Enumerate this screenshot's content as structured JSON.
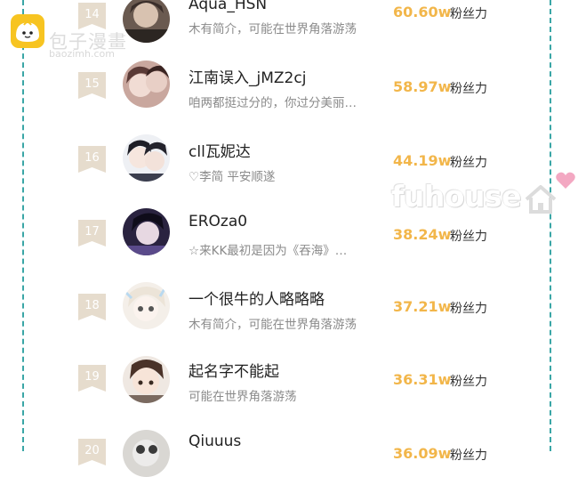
{
  "brand": {
    "title": "包子漫畫",
    "domain": "baozimh.com",
    "icon": "baozi-mascot-icon",
    "accent": "#f7c421"
  },
  "watermark": {
    "text": "fuhouse",
    "icon": "house-heart-icon",
    "heart_color": "#f3a8c2"
  },
  "colors": {
    "fans_number": "#f2b64a",
    "rank_badge": "#e6dccd",
    "dashed_border": "#3aa6a6"
  },
  "ranking": [
    {
      "rank": "14",
      "name": "Aqua_HSN",
      "desc": "木有简介，可能在世界角落游荡",
      "fans": "60.60w",
      "fans_label": "粉丝力"
    },
    {
      "rank": "15",
      "name": "江南误入_jMZ2cj",
      "desc": "咱两都挺过分的，你过分美丽…",
      "fans": "58.97w",
      "fans_label": "粉丝力"
    },
    {
      "rank": "16",
      "name": "cll瓦妮达",
      "desc": "♡李简 平安顺遂",
      "fans": "44.19w",
      "fans_label": "粉丝力"
    },
    {
      "rank": "17",
      "name": "EROza0",
      "desc": "☆来KK最初是因为《吞海》…",
      "fans": "38.24w",
      "fans_label": "粉丝力"
    },
    {
      "rank": "18",
      "name": "一个很牛的人略略略",
      "desc": "木有简介，可能在世界角落游荡",
      "fans": "37.21w",
      "fans_label": "粉丝力"
    },
    {
      "rank": "19",
      "name": "起名字不能起",
      "desc": "可能在世界角落游荡",
      "fans": "36.31w",
      "fans_label": "粉丝力"
    },
    {
      "rank": "20",
      "name": "Qiuuus",
      "desc": "",
      "fans": "36.09w",
      "fans_label": "粉丝力"
    }
  ]
}
